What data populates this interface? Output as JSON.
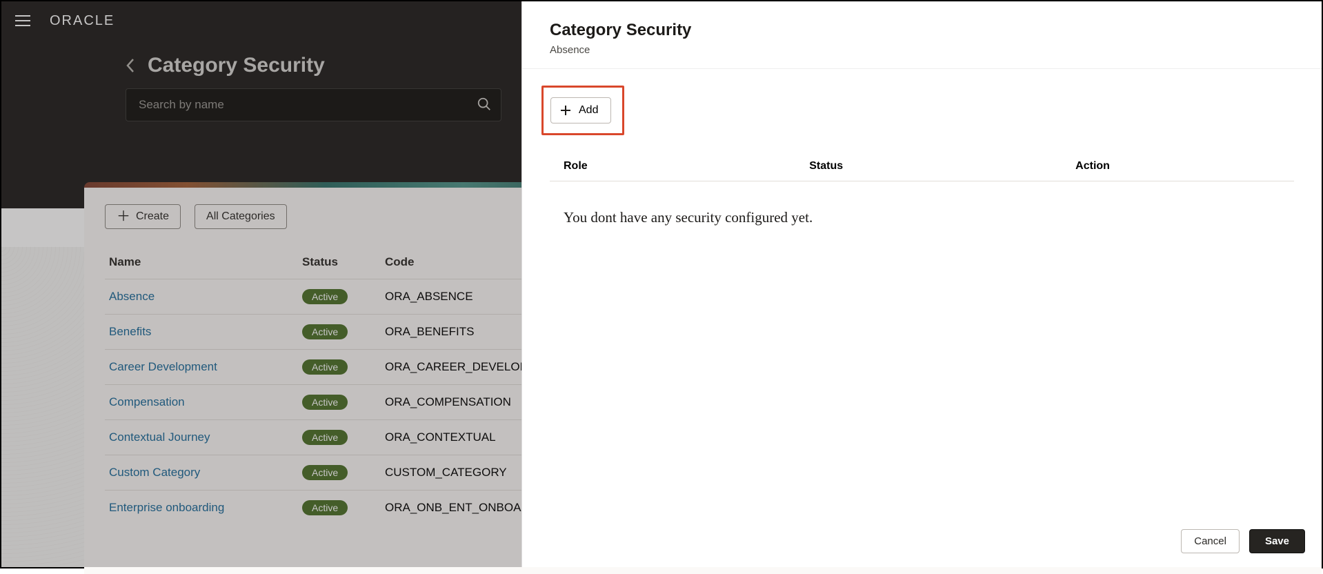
{
  "brand": "ORACLE",
  "page": {
    "title": "Category Security",
    "search_placeholder": "Search by name"
  },
  "toolbar": {
    "create_label": "Create",
    "all_categories_label": "All Categories"
  },
  "columns": {
    "name": "Name",
    "status": "Status",
    "code": "Code"
  },
  "status_active": "Active",
  "rows": [
    {
      "name": "Absence",
      "code": "ORA_ABSENCE"
    },
    {
      "name": "Benefits",
      "code": "ORA_BENEFITS"
    },
    {
      "name": "Career Development",
      "code": "ORA_CAREER_DEVELOPMENT"
    },
    {
      "name": "Compensation",
      "code": "ORA_COMPENSATION"
    },
    {
      "name": "Contextual Journey",
      "code": "ORA_CONTEXTUAL"
    },
    {
      "name": "Custom Category",
      "code": "CUSTOM_CATEGORY"
    },
    {
      "name": "Enterprise onboarding",
      "code": "ORA_ONB_ENT_ONBOARDING"
    }
  ],
  "panel": {
    "title": "Category Security",
    "subtitle": "Absence",
    "add_label": "Add",
    "columns": {
      "role": "Role",
      "status": "Status",
      "action": "Action"
    },
    "empty_message": "You dont have any security configured yet.",
    "cancel_label": "Cancel",
    "save_label": "Save"
  }
}
